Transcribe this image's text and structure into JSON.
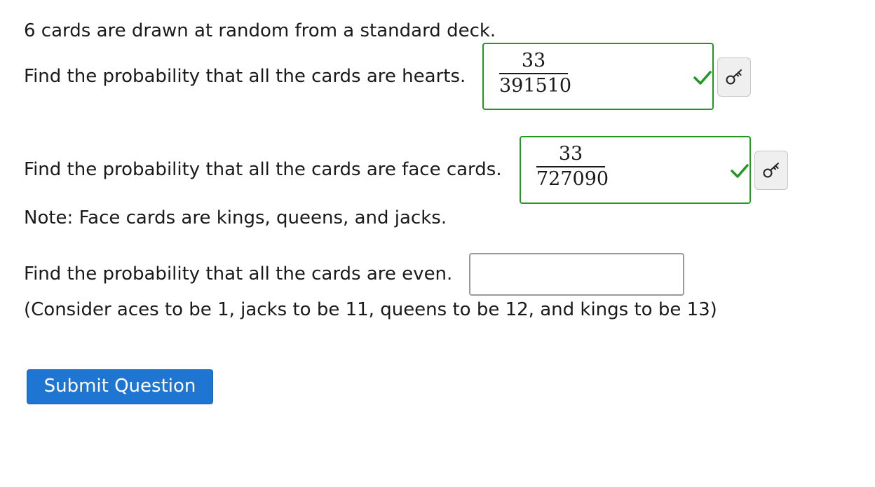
{
  "intro": "6 cards are drawn at random from a standard deck.",
  "questions": [
    {
      "prompt": "Find the probability that all the cards are hearts.",
      "answer": {
        "numerator": "33",
        "denominator": "391510"
      },
      "status": "correct",
      "check_icon": "checkmark-icon",
      "key_icon": "key-icon"
    },
    {
      "prompt": "Find the probability that all the cards are face cards.",
      "answer": {
        "numerator": "33",
        "denominator": "727090"
      },
      "status": "correct",
      "note": "Note: Face cards are kings, queens, and jacks.",
      "check_icon": "checkmark-icon",
      "key_icon": "key-icon"
    },
    {
      "prompt": "Find the probability that all the cards are even.",
      "answer": {
        "value": ""
      },
      "status": "unanswered",
      "note": "(Consider aces to be 1, jacks to be 11, queens to be 12, and kings to be 13)"
    }
  ],
  "submit_label": "Submit Question",
  "colors": {
    "correct": "#1f9a1f",
    "button": "#1f76d2",
    "text": "#1a1a1a"
  }
}
